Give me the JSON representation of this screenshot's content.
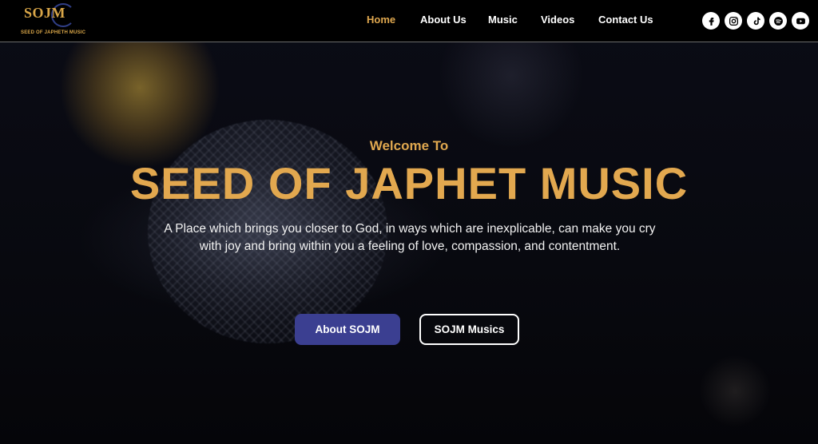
{
  "logo": {
    "mark": "SOJM",
    "subtitle": "SEED OF JAPHETH MUSIC"
  },
  "nav": {
    "items": [
      {
        "label": "Home",
        "active": true
      },
      {
        "label": "About Us",
        "active": false
      },
      {
        "label": "Music",
        "active": false
      },
      {
        "label": "Videos",
        "active": false
      },
      {
        "label": "Contact Us",
        "active": false
      }
    ]
  },
  "socials": [
    {
      "icon": "facebook-icon"
    },
    {
      "icon": "instagram-icon"
    },
    {
      "icon": "tiktok-icon"
    },
    {
      "icon": "spotify-icon"
    },
    {
      "icon": "youtube-icon"
    }
  ],
  "hero": {
    "welcome": "Welcome To",
    "title": "SEED OF JAPHET MUSIC",
    "description": "A Place which brings you closer to God, in ways which are inexplicable, can make you cry with joy and bring within you a feeling of love, compassion, and contentment.",
    "primary_button": "About SOJM",
    "secondary_button": "SOJM Musics"
  },
  "colors": {
    "accent": "#e2a84f",
    "primary_button": "#3b3f91",
    "background": "#05060d"
  }
}
